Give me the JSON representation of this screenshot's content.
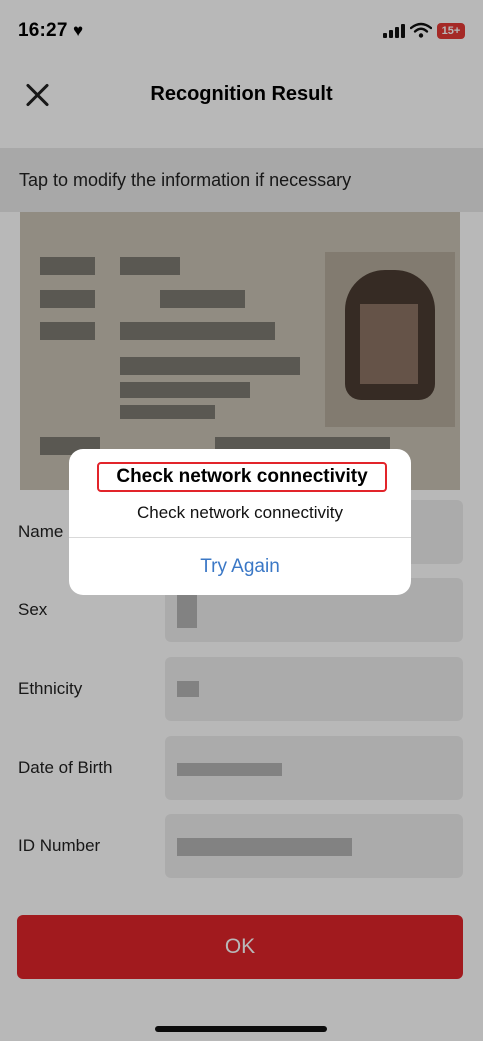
{
  "status_bar": {
    "time": "16:27",
    "battery": "15+",
    "heart_icon": "heart-icon",
    "signal_icon": "cellular-signal-icon",
    "wifi_icon": "wifi-icon"
  },
  "nav": {
    "title": "Recognition Result",
    "close_icon": "close-icon"
  },
  "hint": "Tap to modify the information if necessary",
  "form": [
    {
      "label": "Name",
      "value": ""
    },
    {
      "label": "Sex",
      "value": ""
    },
    {
      "label": "Ethnicity",
      "value": ""
    },
    {
      "label": "Date of Birth",
      "value": ""
    },
    {
      "label": "ID Number",
      "value": ""
    }
  ],
  "ok_button": "OK",
  "alert": {
    "title": "Check network connectivity",
    "message": "Check network connectivity",
    "button": "Try Again",
    "highlight_color": "#e2242a"
  },
  "colors": {
    "primary": "#e0252a",
    "link": "#3b78c6"
  }
}
